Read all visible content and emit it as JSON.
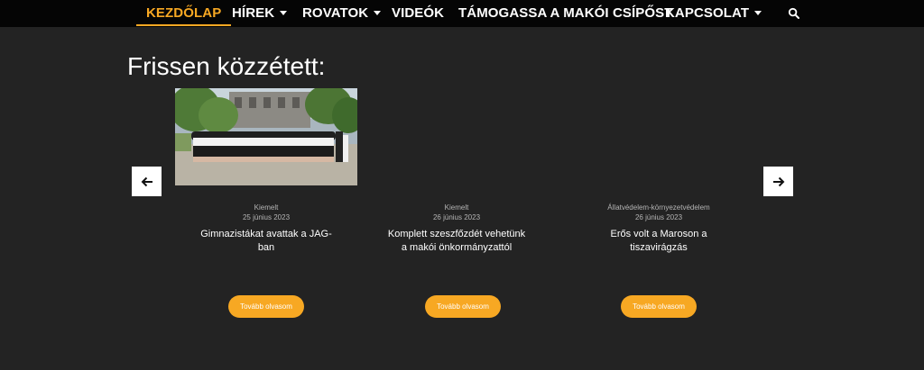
{
  "nav": {
    "items": [
      {
        "label": "KEZDŐLAP",
        "active": true,
        "dropdown": false
      },
      {
        "label": "HÍREK",
        "active": false,
        "dropdown": true
      },
      {
        "label": "ROVATOK",
        "active": false,
        "dropdown": true
      },
      {
        "label": "VIDEÓK",
        "active": false,
        "dropdown": false
      },
      {
        "label": "TÁMOGASSA A MAKÓI CSÍPŐST",
        "active": false,
        "dropdown": false
      },
      {
        "label": "KAPCSOLAT",
        "active": false,
        "dropdown": true
      }
    ],
    "search_icon": "search-icon",
    "accent_color": "#f7a823"
  },
  "section": {
    "title": "Frissen közzétett:"
  },
  "carousel": {
    "prev_icon": "arrow-left-icon",
    "next_icon": "arrow-right-icon",
    "cards": [
      {
        "category": "Kiemelt",
        "date": "25 június 2023",
        "title": "Gimnazistákat avattak a JAG-ban",
        "button": "Tovább olvasom",
        "has_image": true
      },
      {
        "category": "Kiemelt",
        "date": "26 június 2023",
        "title": "Komplett szeszfőzdét vehetünk a makói önkormányzattól",
        "button": "Tovább olvasom",
        "has_image": false
      },
      {
        "category": "Állatvédelem-környezetvédelem",
        "date": "26 június 2023",
        "title": "Erős volt a Maroson a tiszavirágzás",
        "button": "Tovább olvasom",
        "has_image": false
      }
    ]
  }
}
